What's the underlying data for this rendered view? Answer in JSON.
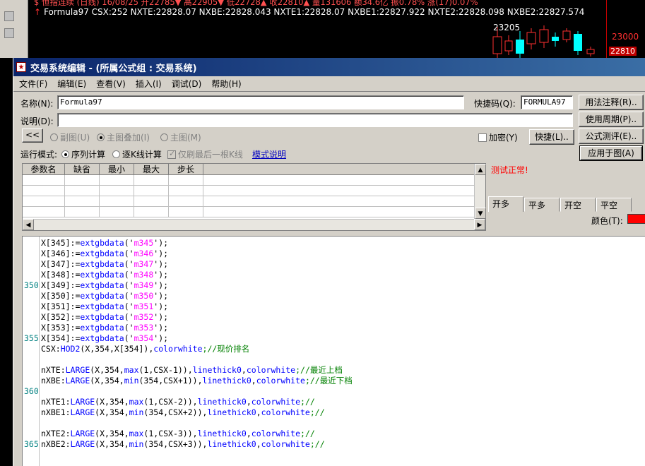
{
  "background": {
    "line1": "$ 恒指连续 (日线) 16/08/25 开22785▼ 高22905▼ 低22728▲ 收22810▲ 量131606 额34.6亿 振0.78% 涨(17)0.07%",
    "line2_arrow": "↑",
    "line2": "Formula97 CSX:252 NXTE:22828.07 NXBE:22828.043 NXTE1:22828.07 NXBE1:22827.922 NXTE2:22828.098 NXBE2:22827.574",
    "price_high": "23205",
    "price_axis_1": "23000",
    "price_axis_2": "22810"
  },
  "dialog": {
    "title": "交易系统编辑 - (所属公式组 : 交易系统)",
    "menu": [
      "文件(F)",
      "编辑(E)",
      "查看(V)",
      "插入(I)",
      "调试(D)",
      "帮助(H)"
    ],
    "name_label": "名称(N):",
    "name_value": "Formula97",
    "shortcut_label": "快捷码(Q):",
    "shortcut_value": "FORMULA97",
    "desc_label": "说明(D):",
    "desc_value": "",
    "back_button": "<<",
    "chart_modes": [
      "副图(U)",
      "主图叠加(I)",
      "主图(M)"
    ],
    "encrypt_label": "加密(Y)",
    "quick_button": "快捷(L)..",
    "right_buttons": [
      "用法注释(R)..",
      "使用周期(P)..",
      "公式测评(E)..",
      "应用于图(A)"
    ],
    "run_mode_label": "运行模式:",
    "run_modes": [
      "序列计算",
      "逐K线计算"
    ],
    "refresh_label": "仅刷最后一根K线",
    "mode_help": "模式说明",
    "param_headers": [
      "参数名",
      "缺省",
      "最小",
      "最大",
      "步长"
    ],
    "test_status": "测试正常!",
    "position_tabs": [
      "开多",
      "平多",
      "开空",
      "平空"
    ],
    "color_label": "颜色(T):",
    "color_value": "#ff0000"
  },
  "editor": {
    "line_numbers": [
      {
        "n": "350",
        "row": 4
      },
      {
        "n": "355",
        "row": 9
      },
      {
        "n": "360",
        "row": 14
      },
      {
        "n": "365",
        "row": 19
      }
    ],
    "lines": [
      [
        {
          "t": "X[345]:=",
          "c": "tx"
        },
        {
          "t": "extgbdata",
          "c": "fn"
        },
        {
          "t": "('",
          "c": "tx"
        },
        {
          "t": "m345",
          "c": "str"
        },
        {
          "t": "');",
          "c": "tx"
        }
      ],
      [
        {
          "t": "X[346]:=",
          "c": "tx"
        },
        {
          "t": "extgbdata",
          "c": "fn"
        },
        {
          "t": "('",
          "c": "tx"
        },
        {
          "t": "m346",
          "c": "str"
        },
        {
          "t": "');",
          "c": "tx"
        }
      ],
      [
        {
          "t": "X[347]:=",
          "c": "tx"
        },
        {
          "t": "extgbdata",
          "c": "fn"
        },
        {
          "t": "('",
          "c": "tx"
        },
        {
          "t": "m347",
          "c": "str"
        },
        {
          "t": "');",
          "c": "tx"
        }
      ],
      [
        {
          "t": "X[348]:=",
          "c": "tx"
        },
        {
          "t": "extgbdata",
          "c": "fn"
        },
        {
          "t": "('",
          "c": "tx"
        },
        {
          "t": "m348",
          "c": "str"
        },
        {
          "t": "');",
          "c": "tx"
        }
      ],
      [
        {
          "t": "X[349]:=",
          "c": "tx"
        },
        {
          "t": "extgbdata",
          "c": "fn"
        },
        {
          "t": "('",
          "c": "tx"
        },
        {
          "t": "m349",
          "c": "str"
        },
        {
          "t": "');",
          "c": "tx"
        }
      ],
      [
        {
          "t": "X[350]:=",
          "c": "tx"
        },
        {
          "t": "extgbdata",
          "c": "fn"
        },
        {
          "t": "('",
          "c": "tx"
        },
        {
          "t": "m350",
          "c": "str"
        },
        {
          "t": "');",
          "c": "tx"
        }
      ],
      [
        {
          "t": "X[351]:=",
          "c": "tx"
        },
        {
          "t": "extgbdata",
          "c": "fn"
        },
        {
          "t": "('",
          "c": "tx"
        },
        {
          "t": "m351",
          "c": "str"
        },
        {
          "t": "');",
          "c": "tx"
        }
      ],
      [
        {
          "t": "X[352]:=",
          "c": "tx"
        },
        {
          "t": "extgbdata",
          "c": "fn"
        },
        {
          "t": "('",
          "c": "tx"
        },
        {
          "t": "m352",
          "c": "str"
        },
        {
          "t": "');",
          "c": "tx"
        }
      ],
      [
        {
          "t": "X[353]:=",
          "c": "tx"
        },
        {
          "t": "extgbdata",
          "c": "fn"
        },
        {
          "t": "('",
          "c": "tx"
        },
        {
          "t": "m353",
          "c": "str"
        },
        {
          "t": "');",
          "c": "tx"
        }
      ],
      [
        {
          "t": "X[354]:=",
          "c": "tx"
        },
        {
          "t": "extgbdata",
          "c": "fn"
        },
        {
          "t": "('",
          "c": "tx"
        },
        {
          "t": "m354",
          "c": "str"
        },
        {
          "t": "');",
          "c": "tx"
        }
      ],
      [
        {
          "t": "CSX:",
          "c": "tx"
        },
        {
          "t": "HOD2",
          "c": "fn"
        },
        {
          "t": "(X,354,X[354]),",
          "c": "tx"
        },
        {
          "t": "colorwhite",
          "c": "fn"
        },
        {
          "t": ";//现价排名",
          "c": "cm"
        }
      ],
      [],
      [
        {
          "t": "nXTE:",
          "c": "tx"
        },
        {
          "t": "LARGE",
          "c": "fn"
        },
        {
          "t": "(X,354,",
          "c": "tx"
        },
        {
          "t": "max",
          "c": "fn"
        },
        {
          "t": "(1,CSX-1)),",
          "c": "tx"
        },
        {
          "t": "linethick0",
          "c": "fn"
        },
        {
          "t": ",",
          "c": "tx"
        },
        {
          "t": "colorwhite",
          "c": "fn"
        },
        {
          "t": ";//最近上档",
          "c": "cm"
        }
      ],
      [
        {
          "t": "nXBE:",
          "c": "tx"
        },
        {
          "t": "LARGE",
          "c": "fn"
        },
        {
          "t": "(X,354,",
          "c": "tx"
        },
        {
          "t": "min",
          "c": "fn"
        },
        {
          "t": "(354,CSX+1)),",
          "c": "tx"
        },
        {
          "t": "linethick0",
          "c": "fn"
        },
        {
          "t": ",",
          "c": "tx"
        },
        {
          "t": "colorwhite",
          "c": "fn"
        },
        {
          "t": ";//最近下档",
          "c": "cm"
        }
      ],
      [],
      [
        {
          "t": "nXTE1:",
          "c": "tx"
        },
        {
          "t": "LARGE",
          "c": "fn"
        },
        {
          "t": "(X,354,",
          "c": "tx"
        },
        {
          "t": "max",
          "c": "fn"
        },
        {
          "t": "(1,CSX-2)),",
          "c": "tx"
        },
        {
          "t": "linethick0",
          "c": "fn"
        },
        {
          "t": ",",
          "c": "tx"
        },
        {
          "t": "colorwhite",
          "c": "fn"
        },
        {
          "t": ";//",
          "c": "cm"
        }
      ],
      [
        {
          "t": "nXBE1:",
          "c": "tx"
        },
        {
          "t": "LARGE",
          "c": "fn"
        },
        {
          "t": "(X,354,",
          "c": "tx"
        },
        {
          "t": "min",
          "c": "fn"
        },
        {
          "t": "(354,CSX+2)),",
          "c": "tx"
        },
        {
          "t": "linethick0",
          "c": "fn"
        },
        {
          "t": ",",
          "c": "tx"
        },
        {
          "t": "colorwhite",
          "c": "fn"
        },
        {
          "t": ";//",
          "c": "cm"
        }
      ],
      [],
      [
        {
          "t": "nXTE2:",
          "c": "tx"
        },
        {
          "t": "LARGE",
          "c": "fn"
        },
        {
          "t": "(X,354,",
          "c": "tx"
        },
        {
          "t": "max",
          "c": "fn"
        },
        {
          "t": "(1,CSX-3)),",
          "c": "tx"
        },
        {
          "t": "linethick0",
          "c": "fn"
        },
        {
          "t": ",",
          "c": "tx"
        },
        {
          "t": "colorwhite",
          "c": "fn"
        },
        {
          "t": ";//",
          "c": "cm"
        }
      ],
      [
        {
          "t": "nXBE2:",
          "c": "tx"
        },
        {
          "t": "LARGE",
          "c": "fn"
        },
        {
          "t": "(X,354,",
          "c": "tx"
        },
        {
          "t": "min",
          "c": "fn"
        },
        {
          "t": "(354,CSX+3)),",
          "c": "tx"
        },
        {
          "t": "linethick0",
          "c": "fn"
        },
        {
          "t": ",",
          "c": "tx"
        },
        {
          "t": "colorwhite",
          "c": "fn"
        },
        {
          "t": ";//",
          "c": "cm"
        }
      ]
    ]
  }
}
